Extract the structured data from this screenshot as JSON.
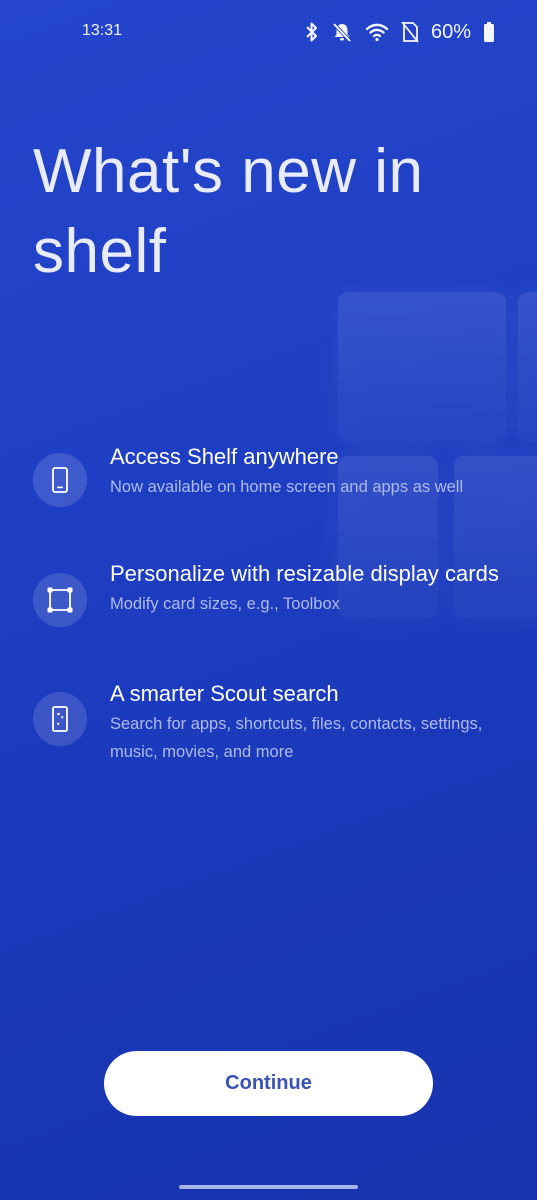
{
  "status_bar": {
    "time": "13:31",
    "battery": "60%",
    "icons": [
      "bluetooth-icon",
      "notifications-off-icon",
      "wifi-icon",
      "no-sim-icon",
      "battery-icon"
    ]
  },
  "title": "What's new in shelf",
  "features": [
    {
      "icon": "phone-icon",
      "heading": "Access Shelf anywhere",
      "description": "Now available on home screen and apps as well"
    },
    {
      "icon": "resize-card-icon",
      "heading": "Personalize with resizable display cards",
      "description": "Modify card sizes, e.g., Toolbox"
    },
    {
      "icon": "scout-search-icon",
      "heading": "A smarter Scout search",
      "description": "Search for apps, shortcuts, files, contacts, settings, music, movies, and more"
    }
  ],
  "continue_label": "Continue",
  "colors": {
    "background": "#1f3fc4",
    "button_text": "#3852b7",
    "description_text": "#aebbf0"
  }
}
